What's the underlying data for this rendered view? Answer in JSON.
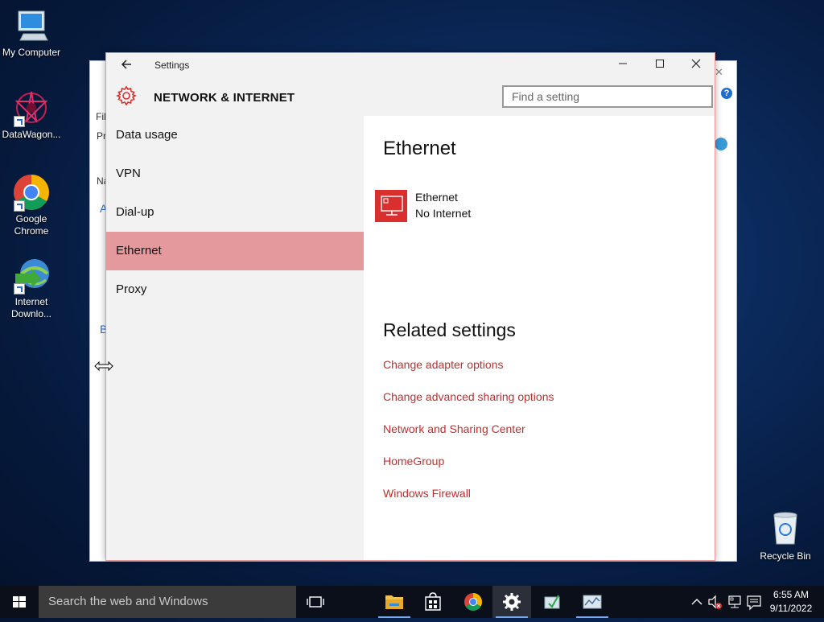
{
  "desktop": {
    "icons": [
      {
        "label": "My Computer"
      },
      {
        "label": "DataWagon..."
      },
      {
        "label": "Google Chrome"
      },
      {
        "label": "Internet Downlo..."
      }
    ],
    "recycle_bin": "Recycle Bin"
  },
  "background_window": {
    "fragments": [
      "Fil",
      "Pr",
      "Na",
      "A",
      "B"
    ]
  },
  "settings": {
    "window_title": "Settings",
    "section_title": "NETWORK & INTERNET",
    "search_placeholder": "Find a setting",
    "nav": [
      {
        "label": "Data usage"
      },
      {
        "label": "VPN"
      },
      {
        "label": "Dial-up"
      },
      {
        "label": "Ethernet",
        "active": true
      },
      {
        "label": "Proxy"
      }
    ],
    "content": {
      "heading": "Ethernet",
      "connection_name": "Ethernet",
      "connection_status": "No Internet",
      "related_heading": "Related settings",
      "related_links": [
        "Change adapter options",
        "Change advanced sharing options",
        "Network and Sharing Center",
        "HomeGroup",
        "Windows Firewall"
      ]
    },
    "colors": {
      "accent": "#d9302f",
      "link": "#c0302f",
      "active_nav": "#e49a9d"
    }
  },
  "taskbar": {
    "search_placeholder": "Search the web and Windows",
    "time": "6:55 AM",
    "date": "9/11/2022"
  }
}
